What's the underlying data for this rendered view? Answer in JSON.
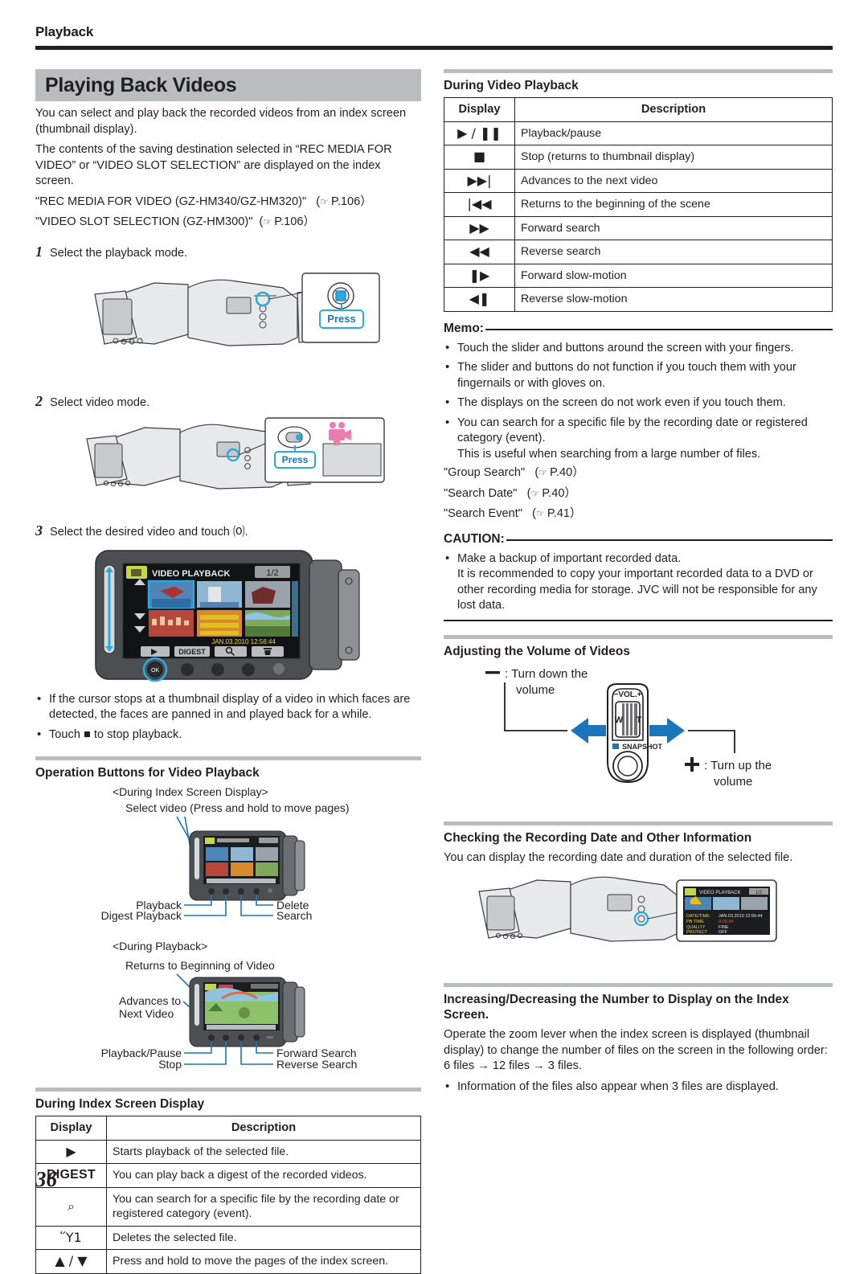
{
  "running_head": "Playback",
  "page_number": "36",
  "left": {
    "title": "Playing Back Videos",
    "intro": [
      "You can select and play back the recorded videos from an index screen (thumbnail display).",
      "The contents of the saving destination selected in “REC MEDIA FOR VIDEO” or “VIDEO SLOT SELECTION” are displayed on the index screen."
    ],
    "refs": [
      {
        "text": "\"REC MEDIA FOR VIDEO (GZ-HM340/GZ-HM320)\"",
        "page": "P.106"
      },
      {
        "text": "\"VIDEO SLOT SELECTION (GZ-HM300)\"",
        "page": "P.106"
      }
    ],
    "steps": [
      {
        "num": "1",
        "text": "Select the playback mode."
      },
      {
        "num": "2",
        "text": "Select video mode."
      },
      {
        "num": "3",
        "text": "Select the desired video and touch ⒪."
      }
    ],
    "step1_callout": {
      "button_label": "Press"
    },
    "step2_callout": {
      "button_label": "Press"
    },
    "step3_screen": {
      "mode_label": "VIDEO PLAYBACK",
      "page_indicator": "1/2",
      "timestamp": "JAN.03.2010 12:56:44",
      "buttons": [
        "▶",
        "DIGEST",
        "⌕",
        "Ὕ1"
      ],
      "ok_label": "OK"
    },
    "notes": [
      "If the cursor stops at a thumbnail display of a video in which faces are detected, the faces are panned in and played back for a while.",
      "Touch ■ to stop playback."
    ],
    "operation_section": {
      "heading": "Operation Buttons for Video Playback",
      "index_caption": "<During Index Screen Display>",
      "index_top_label": "Select video (Press and hold to move pages)",
      "index_labels_left": [
        "Playback",
        "Digest Playback"
      ],
      "index_labels_right": [
        "Delete",
        "Search"
      ],
      "playback_caption": "<During Playback>",
      "playback_top_label": "Returns to Beginning of Video",
      "playback_left_label": "Advances to\nNext Video",
      "playback_labels_left": [
        "Playback/Pause",
        "Stop"
      ],
      "playback_labels_right": [
        "Forward Search",
        "Reverse Search"
      ]
    },
    "index_table": {
      "heading": "During Index Screen Display",
      "columns": [
        "Display",
        "Description"
      ],
      "rows": [
        {
          "icon": "▶",
          "icon_name": "play-icon",
          "desc": "Starts playback of the selected file."
        },
        {
          "icon": "DIGEST",
          "icon_name": "digest-label",
          "desc": "You can play back a digest of the recorded videos."
        },
        {
          "icon": "⌕",
          "icon_name": "search-icon",
          "desc": "You can search for a specific file by the recording date or registered category (event)."
        },
        {
          "icon": "Ὕ1",
          "icon_name": "trash-icon",
          "desc": "Deletes the selected file."
        },
        {
          "icon": "▲ / ▼",
          "icon_name": "up-down-arrows-icon",
          "desc": "Press and hold to move the pages of the index screen."
        }
      ]
    }
  },
  "right": {
    "playback_table": {
      "heading": "During Video Playback",
      "columns": [
        "Display",
        "Description"
      ],
      "rows": [
        {
          "icon": "▶ / ❚❚",
          "icon_name": "play-pause-icon",
          "desc": "Playback/pause"
        },
        {
          "icon": "■",
          "icon_name": "stop-icon",
          "desc": "Stop (returns to thumbnail display)"
        },
        {
          "icon": "▶▶|",
          "icon_name": "next-track-icon",
          "desc": "Advances to the next video"
        },
        {
          "icon": "|◀◀",
          "icon_name": "previous-track-icon",
          "desc": "Returns to the beginning of the scene"
        },
        {
          "icon": "▶▶",
          "icon_name": "fast-forward-icon",
          "desc": "Forward search"
        },
        {
          "icon": "◀◀",
          "icon_name": "rewind-icon",
          "desc": "Reverse search"
        },
        {
          "icon": "❚▶",
          "icon_name": "forward-slow-icon",
          "desc": "Forward slow-motion"
        },
        {
          "icon": "◀❚",
          "icon_name": "reverse-slow-icon",
          "desc": "Reverse slow-motion"
        }
      ]
    },
    "memo": {
      "label": "Memo:",
      "items": [
        "Touch the slider and buttons around the screen with your fingers.",
        "The slider and buttons do not function if you touch them with your fingernails or with gloves on.",
        "The displays on the screen do not work even if you touch them.",
        "You can search for a specific file by the recording date or registered category (event).\nThis is useful when searching from a large number of files."
      ],
      "refs": [
        {
          "text": "\"Group Search\"",
          "page": "P.40"
        },
        {
          "text": "\"Search Date\"",
          "page": "P.40"
        },
        {
          "text": "\"Search Event\"",
          "page": "P.41"
        }
      ]
    },
    "caution": {
      "label": "CAUTION:",
      "items": [
        "Make a backup of important recorded data.\nIt is recommended to copy your important recorded data to a DVD or other recording media for storage. JVC will not be responsible for any lost data."
      ]
    },
    "volume": {
      "heading": "Adjusting the Volume of Videos",
      "minus_label": ": Turn down the\nvolume",
      "plus_label": ": Turn up the\nvolume",
      "lever_label": "VOL.",
      "lever_minus": "−",
      "lever_plus": "+",
      "wide_label": "W",
      "tele_label": "T",
      "snapshot_label": "SNAPSHOT"
    },
    "recdate": {
      "heading": "Checking the Recording Date and Other Information",
      "text": "You can display the recording date and duration of the selected file.",
      "screen": {
        "mode_label": "VIDEO PLAYBACK",
        "page_indicator": "1/2"
      }
    },
    "indexnum": {
      "heading": "Increasing/Decreasing the Number to Display on the Index Screen.",
      "text": "Operate the zoom lever when the index screen is displayed (thumbnail display) to change the number of files on the screen in the following order: 6 files → 12 files → 3 files.",
      "note": "Information of the files also appear when 3 files are displayed."
    }
  },
  "colors": {
    "band": "#b9bdbd",
    "rule": "#231f20",
    "accent_blue": "#1b75bb",
    "cyan": "#29abe2"
  }
}
